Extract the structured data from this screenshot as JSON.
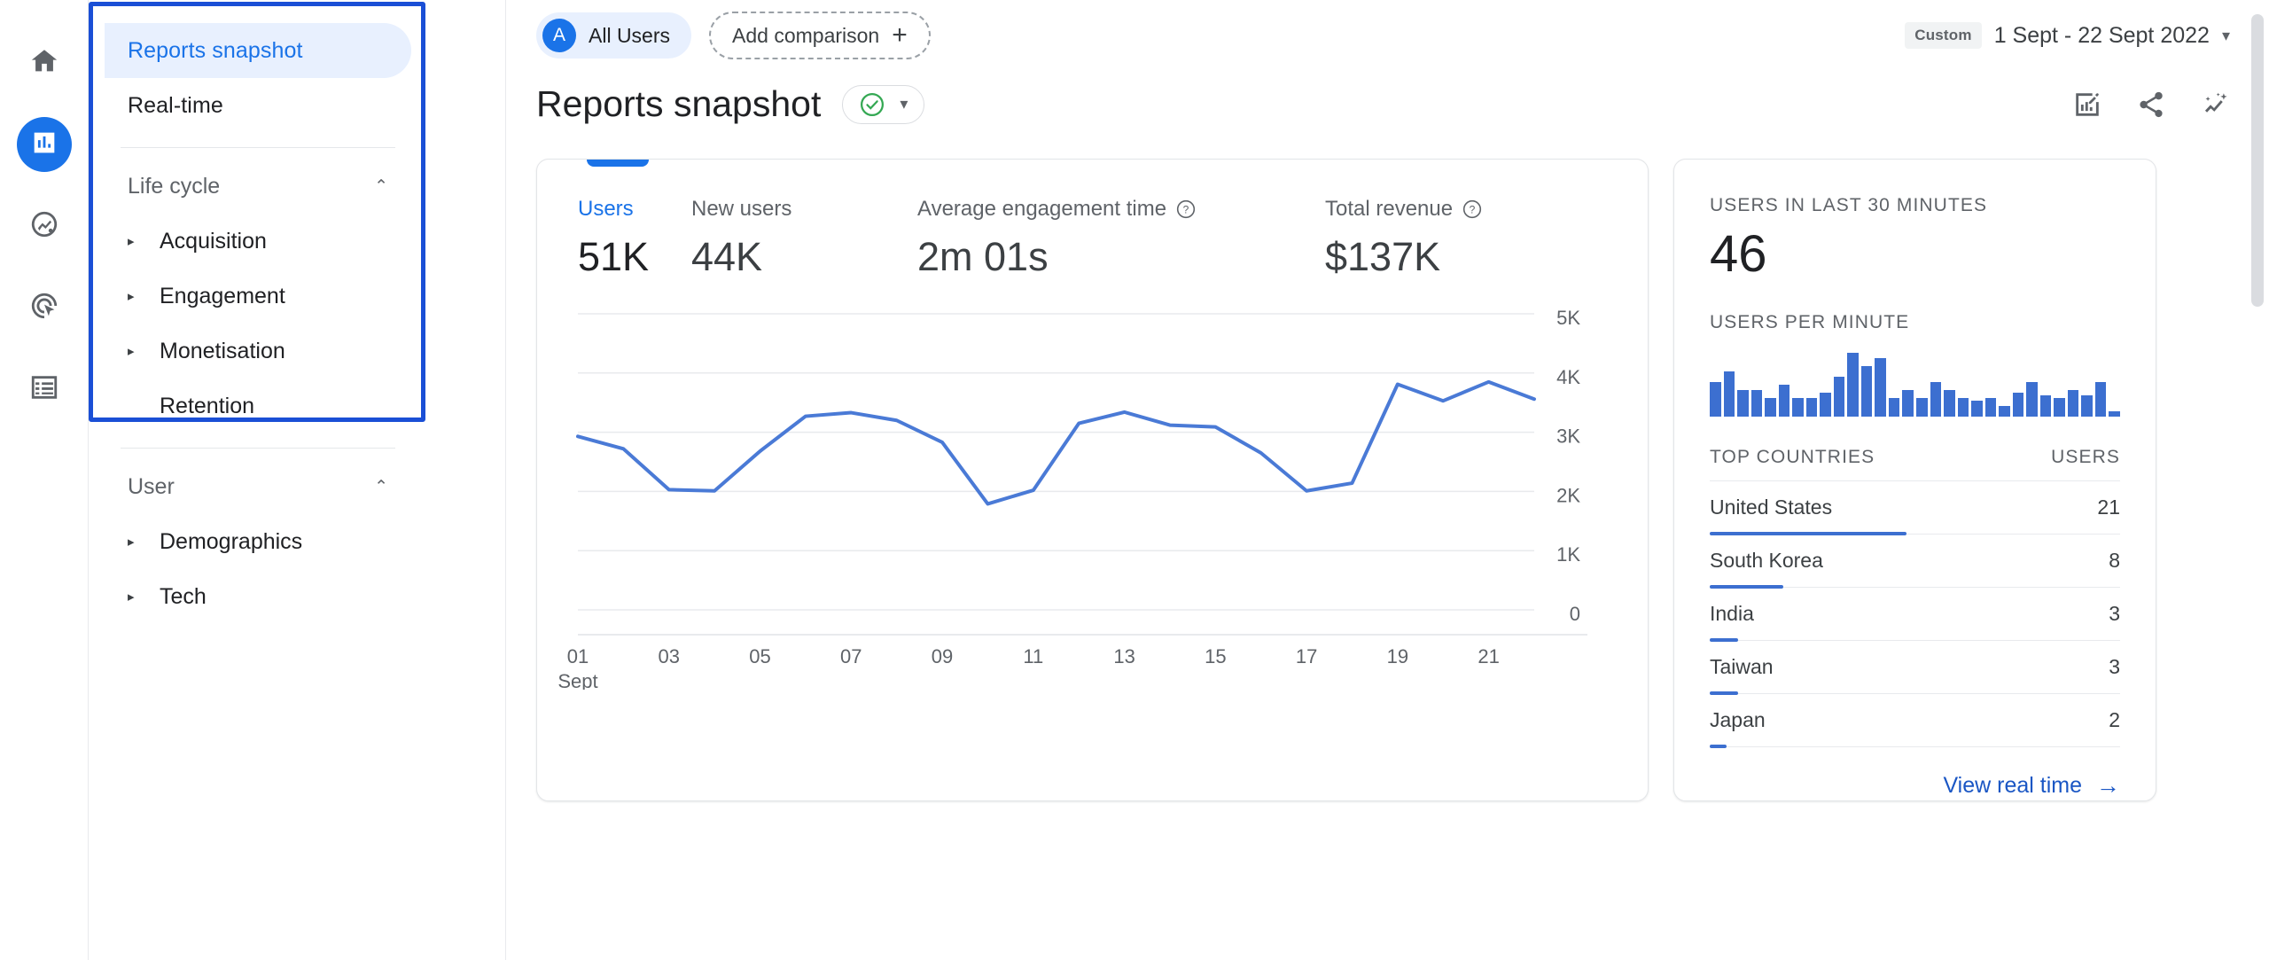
{
  "rail": {
    "items": [
      {
        "icon": "home-icon",
        "name": "home",
        "active": false
      },
      {
        "icon": "reports-bar-chart-icon",
        "name": "reports",
        "active": true
      },
      {
        "icon": "explore-icon",
        "name": "explore",
        "active": false
      },
      {
        "icon": "advertising-target-icon",
        "name": "advertising",
        "active": false
      },
      {
        "icon": "configure-list-icon",
        "name": "configure",
        "active": false
      }
    ]
  },
  "sidebar": {
    "top_items": [
      {
        "label": "Reports snapshot",
        "selected": true
      },
      {
        "label": "Real-time",
        "selected": false
      }
    ],
    "groups": [
      {
        "label": "Life cycle",
        "chevron": "⌃",
        "items": [
          {
            "label": "Acquisition",
            "expandable": true
          },
          {
            "label": "Engagement",
            "expandable": true
          },
          {
            "label": "Monetisation",
            "expandable": true
          },
          {
            "label": "Retention",
            "expandable": false
          }
        ]
      },
      {
        "label": "User",
        "chevron": "⌃",
        "items": [
          {
            "label": "Demographics",
            "expandable": true
          },
          {
            "label": "Tech",
            "expandable": true
          }
        ]
      }
    ]
  },
  "topbar": {
    "audience_initial": "A",
    "audience_label": "All Users",
    "add_comparison_label": "Add comparison",
    "add_comparison_plus": "+",
    "date_badge": "Custom",
    "date_range": "1 Sept - 22 Sept 2022",
    "date_caret": "▾"
  },
  "header": {
    "title": "Reports snapshot",
    "status_icon": "check-circle-green-icon",
    "status_caret": "▾",
    "actions": [
      {
        "name": "customise-report-icon"
      },
      {
        "name": "share-icon"
      },
      {
        "name": "insights-icon"
      }
    ]
  },
  "overview_card": {
    "metrics": [
      {
        "label": "Users",
        "value": "51K",
        "has_help": false,
        "active": true
      },
      {
        "label": "New users",
        "value": "44K",
        "has_help": false,
        "active": false
      },
      {
        "label": "Average engagement time",
        "value": "2m 01s",
        "has_help": true,
        "active": false
      },
      {
        "label": "Total revenue",
        "value": "$137K",
        "has_help": true,
        "active": false
      }
    ]
  },
  "realtime_card": {
    "users_last_30_label": "USERS IN LAST 30 MINUTES",
    "users_last_30_value": "46",
    "users_per_minute_label": "USERS PER MINUTE",
    "users_per_minute": [
      13,
      17,
      10,
      10,
      7,
      12,
      7,
      7,
      9,
      15,
      24,
      19,
      22,
      7,
      10,
      7,
      13,
      10,
      7,
      6,
      7,
      4,
      9,
      13,
      8,
      7,
      10,
      8,
      13,
      2
    ],
    "table": {
      "col_country": "TOP COUNTRIES",
      "col_users": "USERS",
      "rows": [
        {
          "country": "United States",
          "users": "21",
          "pct": 48
        },
        {
          "country": "South Korea",
          "users": "8",
          "pct": 18
        },
        {
          "country": "India",
          "users": "3",
          "pct": 7
        },
        {
          "country": "Taiwan",
          "users": "3",
          "pct": 7
        },
        {
          "country": "Japan",
          "users": "2",
          "pct": 4
        }
      ]
    },
    "view_real_time": "View real time",
    "view_real_time_arrow": "→"
  },
  "colors": {
    "accent": "#1a73e8",
    "line": "#4a7ad6",
    "bar": "#3c6fd0",
    "highlight_border": "#1a4fd6",
    "green": "#34a853",
    "text": "#202124",
    "muted": "#5f6368"
  },
  "chart_data": {
    "type": "line",
    "title": "Users",
    "xlabel": "",
    "ylabel": "Users",
    "x": [
      "01 Sept",
      "02",
      "03",
      "04",
      "05",
      "06",
      "07",
      "08",
      "09",
      "10",
      "11",
      "12",
      "13",
      "14",
      "15",
      "16",
      "17",
      "18",
      "19",
      "20",
      "21",
      "22"
    ],
    "tick_labels": [
      "01\nSept",
      "03",
      "05",
      "07",
      "09",
      "11",
      "13",
      "15",
      "17",
      "19",
      "21"
    ],
    "y_ticks": [
      "0",
      "1K",
      "2K",
      "3K",
      "4K",
      "5K"
    ],
    "ylim": [
      0,
      5000
    ],
    "grid": true,
    "legend": "none",
    "series": [
      {
        "name": "Users",
        "values": [
          2930,
          2720,
          2030,
          2010,
          2680,
          3270,
          3330,
          3200,
          2830,
          1790,
          2020,
          3150,
          3340,
          3120,
          3090,
          2650,
          2010,
          2140,
          3810,
          3530,
          3850,
          3560
        ]
      }
    ]
  }
}
